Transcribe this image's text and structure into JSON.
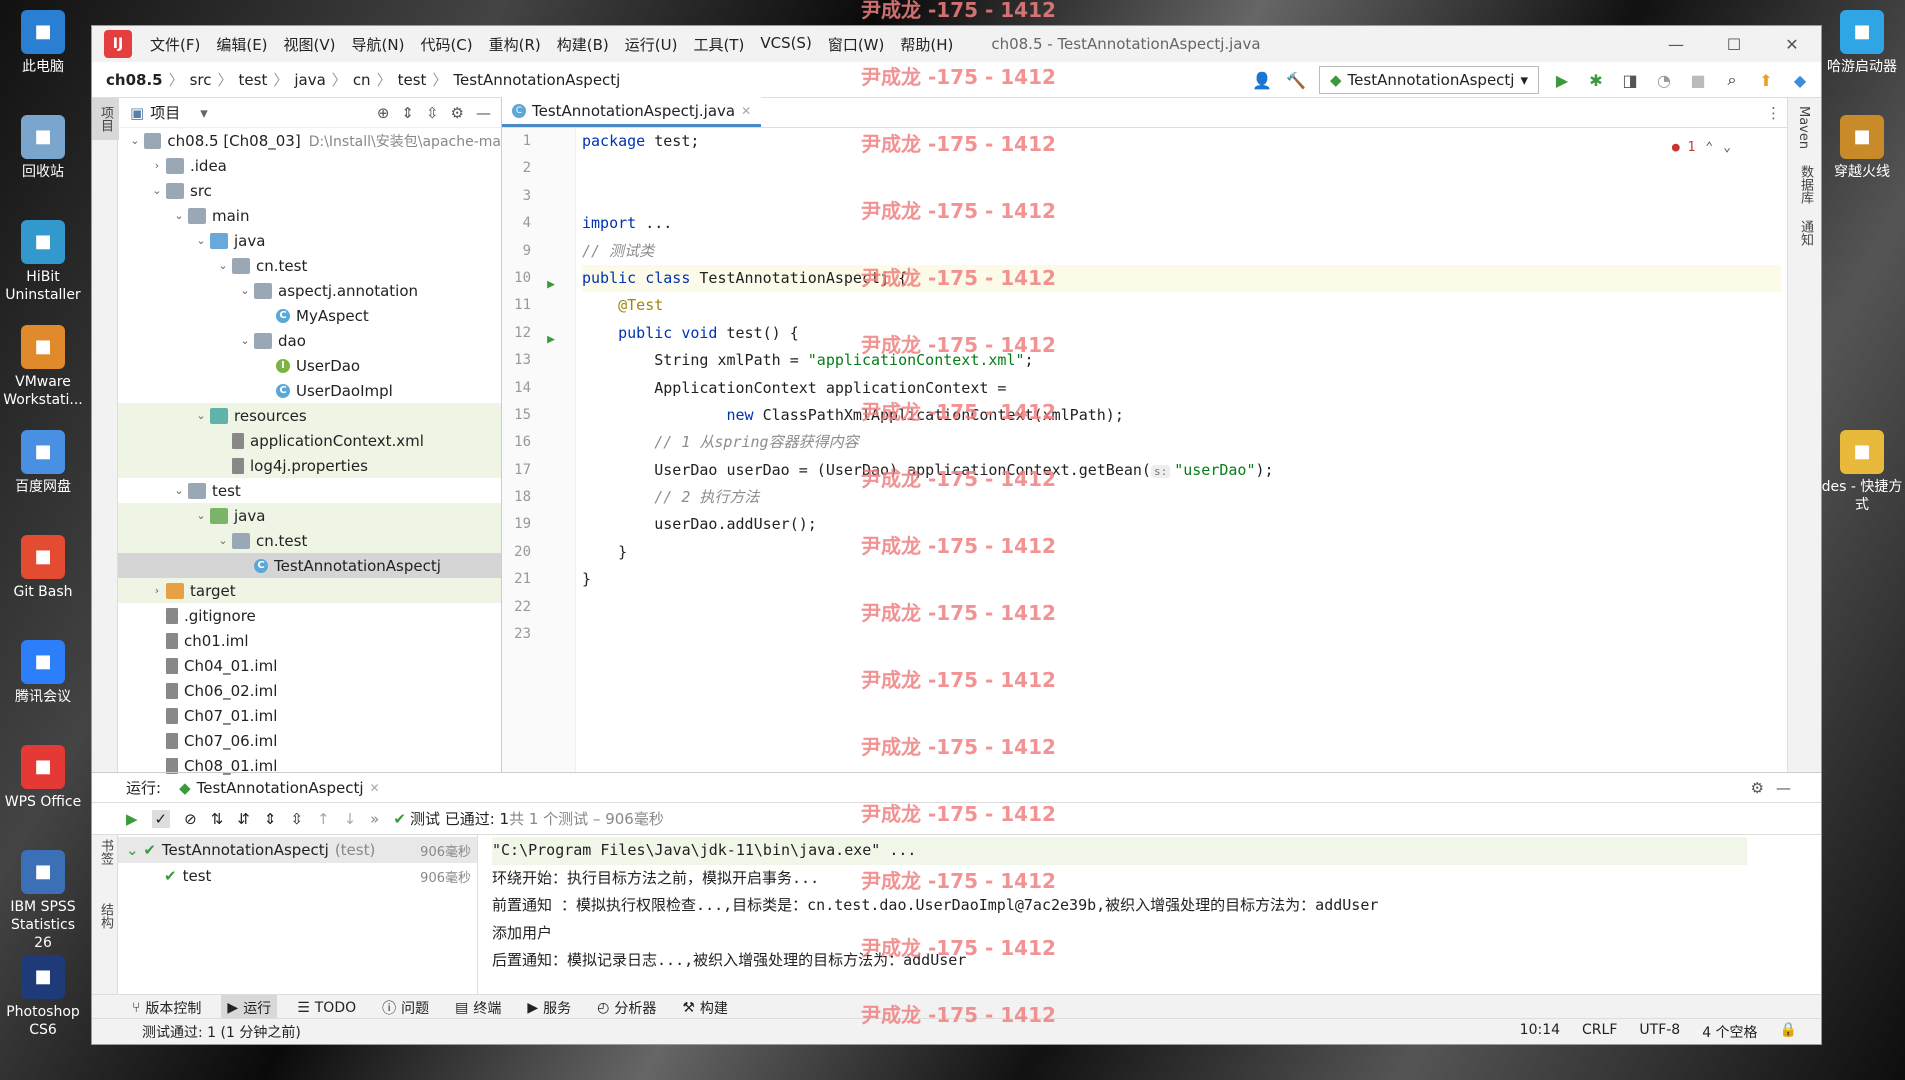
{
  "desktop": {
    "icons_left": [
      {
        "label": "此电脑",
        "color": "#2b7fd3"
      },
      {
        "label": "回收站",
        "color": "#7aa5cc"
      },
      {
        "label": "HiBit Uninstaller",
        "color": "#3399cc"
      },
      {
        "label": "VMware Workstati...",
        "color": "#e08a2c"
      },
      {
        "label": "百度网盘",
        "color": "#4a90e2"
      },
      {
        "label": "Git Bash",
        "color": "#e44c31"
      },
      {
        "label": "腾讯会议",
        "color": "#2d7ff9"
      },
      {
        "label": "WPS Office",
        "color": "#e53935"
      },
      {
        "label": "IBM SPSS Statistics 26",
        "color": "#3b6fb6"
      },
      {
        "label": "Photoshop CS6",
        "color": "#1e3a78"
      }
    ],
    "icons_right": [
      {
        "label": "哈游启动器",
        "color": "#2fa5e6"
      },
      {
        "label": "穿越火线",
        "color": "#c98b2a"
      },
      {
        "label": "des - 快捷方式",
        "color": "#e8b93a"
      }
    ]
  },
  "window": {
    "menus": [
      "文件(F)",
      "编辑(E)",
      "视图(V)",
      "导航(N)",
      "代码(C)",
      "重构(R)",
      "构建(B)",
      "运行(U)",
      "工具(T)",
      "VCS(S)",
      "窗口(W)",
      "帮助(H)"
    ],
    "title": "ch08.5 - TestAnnotationAspectj.java"
  },
  "breadcrumb": [
    "ch08.5",
    "src",
    "test",
    "java",
    "cn",
    "test",
    "TestAnnotationAspectj"
  ],
  "run_config": "TestAnnotationAspectj",
  "left_strip": {
    "project": "项目",
    "bookmarks": "书签",
    "structure": "结构"
  },
  "right_strip": {
    "maven": "Maven",
    "database": "数据库",
    "notifications": "通知"
  },
  "project_panel": {
    "title": "项目",
    "tree": [
      {
        "indent": 0,
        "arrow": "v",
        "icon": "fold",
        "label": "ch08.5 [Ch08_03]",
        "extra": "D:\\Install\\安装包\\apache-ma",
        "bold": true
      },
      {
        "indent": 1,
        "arrow": ">",
        "icon": "fold",
        "label": ".idea"
      },
      {
        "indent": 1,
        "arrow": "v",
        "icon": "fold",
        "label": "src"
      },
      {
        "indent": 2,
        "arrow": "v",
        "icon": "fold",
        "label": "main"
      },
      {
        "indent": 3,
        "arrow": "v",
        "icon": "fold blue",
        "label": "java"
      },
      {
        "indent": 4,
        "arrow": "v",
        "icon": "fold",
        "label": "cn.test"
      },
      {
        "indent": 5,
        "arrow": "v",
        "icon": "fold",
        "label": "aspectj.annotation"
      },
      {
        "indent": 6,
        "arrow": "",
        "icon": "cls",
        "label": "MyAspect"
      },
      {
        "indent": 5,
        "arrow": "v",
        "icon": "fold",
        "label": "dao"
      },
      {
        "indent": 6,
        "arrow": "",
        "icon": "int",
        "label": "UserDao"
      },
      {
        "indent": 6,
        "arrow": "",
        "icon": "cls",
        "label": "UserDaoImpl"
      },
      {
        "indent": 3,
        "arrow": "v",
        "icon": "fold teal",
        "label": "resources",
        "green": true
      },
      {
        "indent": 4,
        "arrow": "",
        "icon": "file",
        "label": "applicationContext.xml",
        "green": true
      },
      {
        "indent": 4,
        "arrow": "",
        "icon": "file",
        "label": "log4j.properties",
        "green": true
      },
      {
        "indent": 2,
        "arrow": "v",
        "icon": "fold",
        "label": "test"
      },
      {
        "indent": 3,
        "arrow": "v",
        "icon": "fold green",
        "label": "java",
        "green": true
      },
      {
        "indent": 4,
        "arrow": "v",
        "icon": "fold",
        "label": "cn.test",
        "green": true
      },
      {
        "indent": 5,
        "arrow": "",
        "icon": "cls",
        "label": "TestAnnotationAspectj",
        "selected": true
      },
      {
        "indent": 1,
        "arrow": ">",
        "icon": "fold orange",
        "label": "target",
        "green": true
      },
      {
        "indent": 1,
        "arrow": "",
        "icon": "file",
        "label": ".gitignore"
      },
      {
        "indent": 1,
        "arrow": "",
        "icon": "file",
        "label": "ch01.iml"
      },
      {
        "indent": 1,
        "arrow": "",
        "icon": "file",
        "label": "Ch04_01.iml"
      },
      {
        "indent": 1,
        "arrow": "",
        "icon": "file",
        "label": "Ch06_02.iml"
      },
      {
        "indent": 1,
        "arrow": "",
        "icon": "file",
        "label": "Ch07_01.iml"
      },
      {
        "indent": 1,
        "arrow": "",
        "icon": "file",
        "label": "Ch07_06.iml"
      },
      {
        "indent": 1,
        "arrow": "",
        "icon": "file",
        "label": "Ch08_01.iml"
      }
    ]
  },
  "editor": {
    "tab": "TestAnnotationAspectj.java",
    "error_count": "1",
    "line_numbers": [
      "1",
      "2",
      "3",
      "4",
      "9",
      "10",
      "11",
      "12",
      "13",
      "14",
      "15",
      "16",
      "17",
      "18",
      "19",
      "20",
      "21",
      "22",
      "23"
    ],
    "lines": [
      "<span class=\"kw\">package</span> test;",
      "",
      "",
      "<span class=\"kw\">import</span> ...",
      "<span class=\"cm\">// 测试类</span>",
      "<span class=\"kw\">public class</span> TestAnnotationAspectj {",
      "    <span class=\"ann\">@Test</span>",
      "    <span class=\"kw\">public void</span> test() {",
      "        String xmlPath = <span class=\"str\">\"applicationContext.xml\"</span>;",
      "        ApplicationContext applicationContext =",
      "                <span class=\"kw\">new</span> ClassPathXmlApplicationContext(xmlPath);",
      "        <span class=\"cm\">// 1 从spring容器获得内容</span>",
      "        UserDao userDao = (UserDao) applicationContext.getBean(<span class=\"hint\">s:</span><span class=\"str\">\"userDao\"</span>);",
      "        <span class=\"cm\">// 2 执行方法</span>",
      "        userDao.addUser();",
      "    }",
      "}",
      "",
      ""
    ]
  },
  "run_panel": {
    "label": "运行:",
    "tab": "TestAnnotationAspectj",
    "status_passed": "测试 已通过: 1",
    "status_detail": "共 1 个测试 – 906毫秒",
    "tests": [
      {
        "name": "TestAnnotationAspectj",
        "suffix": "(test)",
        "time": "906毫秒"
      },
      {
        "name": "test",
        "suffix": "",
        "time": "906毫秒"
      }
    ],
    "console": [
      "\"C:\\Program Files\\Java\\jdk-11\\bin\\java.exe\" ...",
      "环绕开始：执行目标方法之前，模拟开启事务...",
      "前置通知 ：模拟执行权限检查...,目标类是：cn.test.dao.UserDaoImpl@7ac2e39b,被织入增强处理的目标方法为：addUser",
      "添加用户",
      "后置通知：模拟记录日志...,被织入增强处理的目标方法为：addUser"
    ]
  },
  "bottom_tools": [
    "版本控制",
    "运行",
    "TODO",
    "问题",
    "终端",
    "服务",
    "分析器",
    "构建"
  ],
  "status": {
    "message": "测试通过: 1 (1 分钟之前)",
    "position": "10:14",
    "line_sep": "CRLF",
    "encoding": "UTF-8",
    "indent": "4 个空格"
  },
  "watermark": "尹成龙 -175 - 1412"
}
